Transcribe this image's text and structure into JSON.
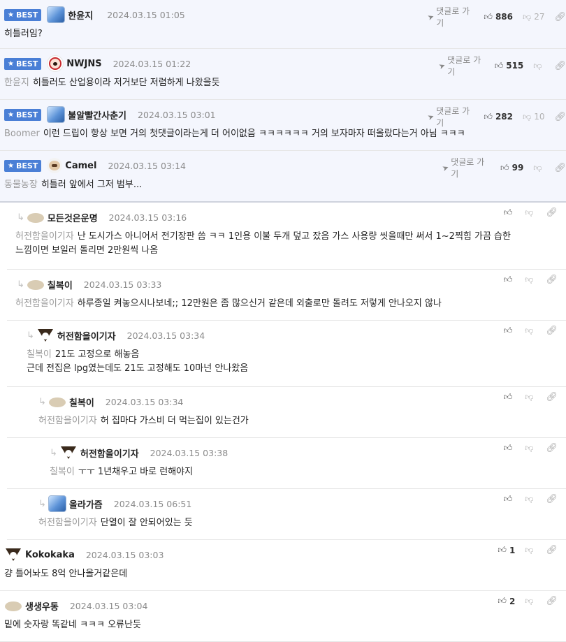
{
  "best_label": "BEST",
  "goto_label": "댓글로 가기",
  "comments": [
    {
      "best": true,
      "depth": 0,
      "avatar": "blue",
      "nick": "한윤지",
      "time": "2024.03.15 01:05",
      "mention": "",
      "lines": [
        "히틀러임?"
      ],
      "goto": true,
      "up": "886",
      "down": "27",
      "h": 70,
      "nickgap": 20,
      "actx": 612
    },
    {
      "best": true,
      "depth": 0,
      "avatar": "red",
      "nick": "NWJNS",
      "time": "2024.03.15 01:22",
      "mention": "한윤지",
      "lines": [
        "히틀러도 산업용이라 저거보단 저렴하게 나왔을듯"
      ],
      "goto": true,
      "up": "515",
      "down": "",
      "h": 73,
      "nickgap": 16,
      "actx": 628
    },
    {
      "best": true,
      "depth": 0,
      "avatar": "blue",
      "nick": "불알빨간사춘기",
      "time": "2024.03.15 03:01",
      "mention": "Boomer",
      "lines": [
        "이런 드립이 항상 보면 거의 첫댓글이라는게 더 어이없음 ㅋㅋㅋㅋㅋㅋ 거의 보자마자 떠올랐다는거 아님 ㅋㅋㅋ"
      ],
      "goto": true,
      "up": "282",
      "down": "10",
      "h": 73,
      "nickgap": 16,
      "actx": 612
    },
    {
      "best": true,
      "depth": 0,
      "avatar": "dog",
      "nick": "Camel",
      "time": "2024.03.15 03:14",
      "mention": "동물농장",
      "lines": [
        "히틀러 앞에서 그저 범부..."
      ],
      "goto": true,
      "up": "99",
      "down": "",
      "h": 74,
      "nickgap": 16,
      "actx": 633,
      "boundary": true
    },
    {
      "best": false,
      "depth": 1,
      "avatar": "blob",
      "nick": "모든것은운명",
      "time": "2024.03.15 03:16",
      "mention": "허전함을이기자",
      "lines": [
        "난 도시가스 아니어서 전기장판 씀 ㅋㅋ 1인용 이불 두개 덮고 잤음 가스 사용량 씻을때만 써서 1~2찍힘 가끔 습한",
        "느낌이면 보일러 돌리면 2만원씩 나옴"
      ],
      "goto": false,
      "up": "",
      "down": "",
      "h": 96,
      "nickgap": 16
    },
    {
      "best": false,
      "depth": 1,
      "avatar": "blob",
      "nick": "칠복이",
      "time": "2024.03.15 03:33",
      "mention": "허전함을이기자",
      "lines": [
        "하루종일 켜놓으시나보네;; 12만원은 좀 많으신거 같은데 외출로만 돌려도 저렇게 안나오지 않나"
      ],
      "goto": false,
      "up": "",
      "down": "",
      "h": 73,
      "nickgap": 16
    },
    {
      "best": false,
      "depth": 2,
      "avatar": "fox",
      "nick": "허전함을이기자",
      "time": "2024.03.15 03:34",
      "mention": "칠복이",
      "lines": [
        "21도 고정으로 해놓음",
        "근데 전집은 lpg였는데도 21도 고정해도 10마넌 안나왔음"
      ],
      "goto": false,
      "up": "",
      "down": "",
      "h": 95,
      "nickgap": 16
    },
    {
      "best": false,
      "depth": 3,
      "avatar": "blob",
      "nick": "칠복이",
      "time": "2024.03.15 03:34",
      "mention": "허전함을이기자",
      "lines": [
        "허 집마다 가스비 더 먹는집이 있는건가"
      ],
      "goto": false,
      "up": "",
      "down": "",
      "h": 73,
      "nickgap": 16
    },
    {
      "best": false,
      "depth": 4,
      "avatar": "fox",
      "nick": "허전함을이기자",
      "time": "2024.03.15 03:38",
      "mention": "칠복이",
      "lines": [
        "ㅜㅜ 1년채우고 바로 런해야지"
      ],
      "goto": false,
      "up": "",
      "down": "",
      "h": 73,
      "nickgap": 16
    },
    {
      "best": false,
      "depth": 3,
      "avatar": "blue",
      "nick": "올라가즘",
      "time": "2024.03.15 06:51",
      "mention": "허전함을이기자",
      "lines": [
        "단열이 잘 안되어있는 듯"
      ],
      "goto": false,
      "up": "",
      "down": "",
      "h": 73,
      "nickgap": 16
    },
    {
      "best": false,
      "depth": 0,
      "avatar": "fox",
      "nick": "Kokokaka",
      "time": "2024.03.15 03:03",
      "mention": "",
      "lines": [
        "걍 틀어놔도 8억 안나올거같은데"
      ],
      "goto": false,
      "up": "1",
      "down": "",
      "h": 73,
      "nickgap": 16
    },
    {
      "best": false,
      "depth": 0,
      "avatar": "blob",
      "nick": "생생우동",
      "time": "2024.03.15 03:04",
      "mention": "",
      "lines": [
        "밑에 숫자랑 똑같네 ㅋㅋㅋ 오류난듯"
      ],
      "goto": false,
      "up": "2",
      "down": "",
      "h": 73,
      "nickgap": 16
    }
  ]
}
